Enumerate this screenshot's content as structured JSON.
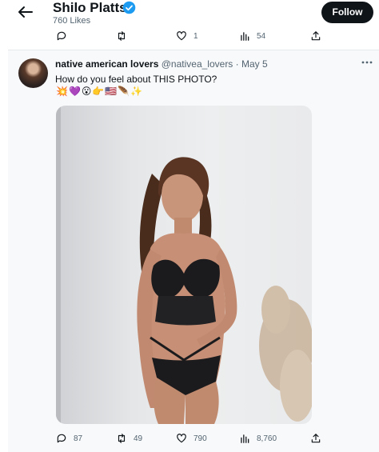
{
  "profile": {
    "name": "Shilo Platts",
    "likes": "760 Likes",
    "follow_label": "Follow"
  },
  "top_actions": {
    "replies": "",
    "retweets": "",
    "likes": "1",
    "views": "54"
  },
  "tweet": {
    "display_name": "native american lovers",
    "handle": "@nativea_lovers",
    "separator": "·",
    "date": "May 5",
    "text": "How do you feel about THIS PHOTO?",
    "emojis": "💥💜😮👉🇺🇸🪶✨",
    "photo_alt": "Photo",
    "stats": {
      "replies": "87",
      "retweets": "49",
      "likes": "790",
      "views": "8,760"
    }
  },
  "colors": {
    "text_primary": "#0f1419",
    "text_secondary": "#536471",
    "verified_blue": "#1d9bf0",
    "follow_bg": "#0f1419",
    "tweet_bg": "#f8f9fa"
  }
}
